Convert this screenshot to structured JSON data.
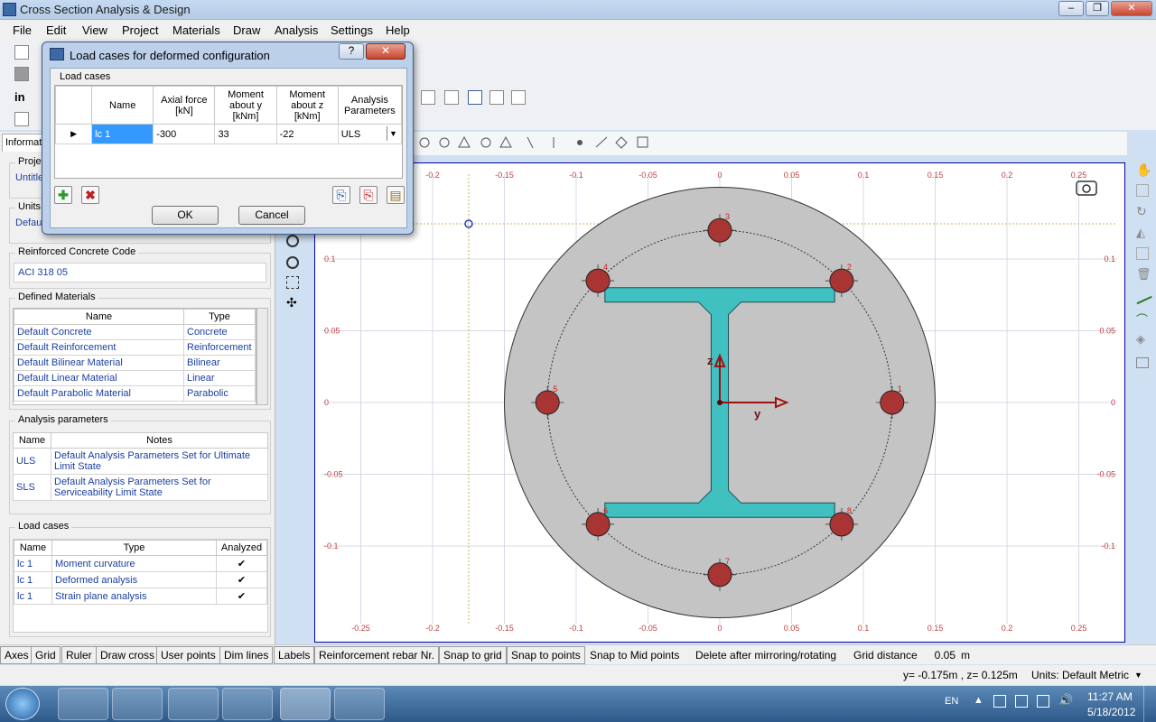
{
  "window": {
    "title": "Cross Section Analysis & Design",
    "minimize": "‒",
    "maximize": "❐",
    "close": "✕"
  },
  "menu": [
    "File",
    "Edit",
    "View",
    "Project",
    "Materials",
    "Draw",
    "Analysis",
    "Settings",
    "Help"
  ],
  "left_panel": {
    "tab_label": "Informat",
    "project_label": "Projec",
    "project_value": "Untitle",
    "units_label": "Units",
    "units_value": "Defau",
    "code_label": "Reinforced Concrete Code",
    "code_value": "ACI 318 05",
    "materials": {
      "title": "Defined Materials",
      "headers": [
        "Name",
        "Type"
      ],
      "rows": [
        [
          "Default Concrete",
          "Concrete"
        ],
        [
          "Default Reinforcement",
          "Reinforcement"
        ],
        [
          "Default Bilinear Material",
          "Bilinear"
        ],
        [
          "Default Linear Material",
          "Linear"
        ],
        [
          "Default Parabolic Material",
          "Parabolic"
        ]
      ]
    },
    "analysis_params": {
      "title": "Analysis parameters",
      "headers": [
        "Name",
        "Notes"
      ],
      "rows": [
        [
          "ULS",
          "Default Analysis Parameters Set for Ultimate Limit State"
        ],
        [
          "SLS",
          "Default Analysis Parameters Set for Serviceability Limit State"
        ]
      ]
    },
    "load_cases": {
      "title": "Load cases",
      "headers": [
        "Name",
        "Type",
        "Analyzed"
      ],
      "rows": [
        [
          "lc 1",
          "Moment curvature",
          "✔"
        ],
        [
          "lc 1",
          "Deformed analysis",
          "✔"
        ],
        [
          "lc 1",
          "Strain plane analysis",
          "✔"
        ]
      ]
    }
  },
  "dialog": {
    "title": "Load cases for deformed configuration",
    "help": "?",
    "close": "✕",
    "group_title": "Load cases",
    "headers": [
      "Name",
      "Axial force [kN]",
      "Moment about y [kNm]",
      "Moment about z [kNm]",
      "Analysis Parameters"
    ],
    "row": {
      "name": "lc 1",
      "axial": "-300",
      "my": "33",
      "mz": "-22",
      "params": "ULS"
    },
    "ok": "OK",
    "cancel": "Cancel"
  },
  "canvas": {
    "x_ticks": [
      "-0.25",
      "-0.2",
      "-0.15",
      "-0.1",
      "-0.05",
      "0",
      "0.05",
      "0.1",
      "0.15",
      "0.2",
      "0.25"
    ],
    "y_ticks": [
      "0.1",
      "0.05",
      "0",
      "-0.05",
      "-0.1"
    ],
    "rebar_labels": [
      "1",
      "2",
      "3",
      "4",
      "5",
      "6",
      "7",
      "8"
    ],
    "axis_y": "y",
    "axis_z": "z",
    "colors": {
      "concrete": "#c4c4c4",
      "steel": "#40c0c0",
      "rebar": "#a83434",
      "grid": "#d8d8e8"
    }
  },
  "status": {
    "buttons": [
      "Axes",
      "Grid",
      "Ruler",
      "Draw cross",
      "User points",
      "Dim lines",
      "Labels",
      "Reinforcement rebar Nr.",
      "Snap to grid",
      "Snap to points"
    ],
    "snap_mid": "Snap to Mid points",
    "delete_after": "Delete after mirroring/rotating",
    "grid_distance_label": "Grid distance",
    "grid_distance_value": "0.05",
    "grid_unit": "m"
  },
  "info": {
    "coords": "y= -0.175m , z= 0.125m",
    "units": "Units: Default Metric"
  },
  "taskbar": {
    "lang": "EN",
    "time": "11:27 AM",
    "date": "5/18/2012"
  }
}
